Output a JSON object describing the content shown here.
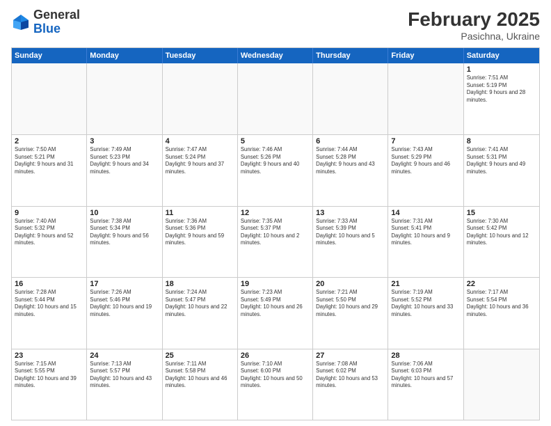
{
  "header": {
    "logo_general": "General",
    "logo_blue": "Blue",
    "month_title": "February 2025",
    "location": "Pasichna, Ukraine"
  },
  "weekdays": [
    "Sunday",
    "Monday",
    "Tuesday",
    "Wednesday",
    "Thursday",
    "Friday",
    "Saturday"
  ],
  "weeks": [
    [
      {
        "day": "",
        "info": "",
        "empty": true
      },
      {
        "day": "",
        "info": "",
        "empty": true
      },
      {
        "day": "",
        "info": "",
        "empty": true
      },
      {
        "day": "",
        "info": "",
        "empty": true
      },
      {
        "day": "",
        "info": "",
        "empty": true
      },
      {
        "day": "",
        "info": "",
        "empty": true
      },
      {
        "day": "1",
        "info": "Sunrise: 7:51 AM\nSunset: 5:19 PM\nDaylight: 9 hours and 28 minutes.",
        "empty": false
      }
    ],
    [
      {
        "day": "2",
        "info": "Sunrise: 7:50 AM\nSunset: 5:21 PM\nDaylight: 9 hours and 31 minutes.",
        "empty": false
      },
      {
        "day": "3",
        "info": "Sunrise: 7:49 AM\nSunset: 5:23 PM\nDaylight: 9 hours and 34 minutes.",
        "empty": false
      },
      {
        "day": "4",
        "info": "Sunrise: 7:47 AM\nSunset: 5:24 PM\nDaylight: 9 hours and 37 minutes.",
        "empty": false
      },
      {
        "day": "5",
        "info": "Sunrise: 7:46 AM\nSunset: 5:26 PM\nDaylight: 9 hours and 40 minutes.",
        "empty": false
      },
      {
        "day": "6",
        "info": "Sunrise: 7:44 AM\nSunset: 5:28 PM\nDaylight: 9 hours and 43 minutes.",
        "empty": false
      },
      {
        "day": "7",
        "info": "Sunrise: 7:43 AM\nSunset: 5:29 PM\nDaylight: 9 hours and 46 minutes.",
        "empty": false
      },
      {
        "day": "8",
        "info": "Sunrise: 7:41 AM\nSunset: 5:31 PM\nDaylight: 9 hours and 49 minutes.",
        "empty": false
      }
    ],
    [
      {
        "day": "9",
        "info": "Sunrise: 7:40 AM\nSunset: 5:32 PM\nDaylight: 9 hours and 52 minutes.",
        "empty": false
      },
      {
        "day": "10",
        "info": "Sunrise: 7:38 AM\nSunset: 5:34 PM\nDaylight: 9 hours and 56 minutes.",
        "empty": false
      },
      {
        "day": "11",
        "info": "Sunrise: 7:36 AM\nSunset: 5:36 PM\nDaylight: 9 hours and 59 minutes.",
        "empty": false
      },
      {
        "day": "12",
        "info": "Sunrise: 7:35 AM\nSunset: 5:37 PM\nDaylight: 10 hours and 2 minutes.",
        "empty": false
      },
      {
        "day": "13",
        "info": "Sunrise: 7:33 AM\nSunset: 5:39 PM\nDaylight: 10 hours and 5 minutes.",
        "empty": false
      },
      {
        "day": "14",
        "info": "Sunrise: 7:31 AM\nSunset: 5:41 PM\nDaylight: 10 hours and 9 minutes.",
        "empty": false
      },
      {
        "day": "15",
        "info": "Sunrise: 7:30 AM\nSunset: 5:42 PM\nDaylight: 10 hours and 12 minutes.",
        "empty": false
      }
    ],
    [
      {
        "day": "16",
        "info": "Sunrise: 7:28 AM\nSunset: 5:44 PM\nDaylight: 10 hours and 15 minutes.",
        "empty": false
      },
      {
        "day": "17",
        "info": "Sunrise: 7:26 AM\nSunset: 5:46 PM\nDaylight: 10 hours and 19 minutes.",
        "empty": false
      },
      {
        "day": "18",
        "info": "Sunrise: 7:24 AM\nSunset: 5:47 PM\nDaylight: 10 hours and 22 minutes.",
        "empty": false
      },
      {
        "day": "19",
        "info": "Sunrise: 7:23 AM\nSunset: 5:49 PM\nDaylight: 10 hours and 26 minutes.",
        "empty": false
      },
      {
        "day": "20",
        "info": "Sunrise: 7:21 AM\nSunset: 5:50 PM\nDaylight: 10 hours and 29 minutes.",
        "empty": false
      },
      {
        "day": "21",
        "info": "Sunrise: 7:19 AM\nSunset: 5:52 PM\nDaylight: 10 hours and 33 minutes.",
        "empty": false
      },
      {
        "day": "22",
        "info": "Sunrise: 7:17 AM\nSunset: 5:54 PM\nDaylight: 10 hours and 36 minutes.",
        "empty": false
      }
    ],
    [
      {
        "day": "23",
        "info": "Sunrise: 7:15 AM\nSunset: 5:55 PM\nDaylight: 10 hours and 39 minutes.",
        "empty": false
      },
      {
        "day": "24",
        "info": "Sunrise: 7:13 AM\nSunset: 5:57 PM\nDaylight: 10 hours and 43 minutes.",
        "empty": false
      },
      {
        "day": "25",
        "info": "Sunrise: 7:11 AM\nSunset: 5:58 PM\nDaylight: 10 hours and 46 minutes.",
        "empty": false
      },
      {
        "day": "26",
        "info": "Sunrise: 7:10 AM\nSunset: 6:00 PM\nDaylight: 10 hours and 50 minutes.",
        "empty": false
      },
      {
        "day": "27",
        "info": "Sunrise: 7:08 AM\nSunset: 6:02 PM\nDaylight: 10 hours and 53 minutes.",
        "empty": false
      },
      {
        "day": "28",
        "info": "Sunrise: 7:06 AM\nSunset: 6:03 PM\nDaylight: 10 hours and 57 minutes.",
        "empty": false
      },
      {
        "day": "",
        "info": "",
        "empty": true
      }
    ]
  ]
}
